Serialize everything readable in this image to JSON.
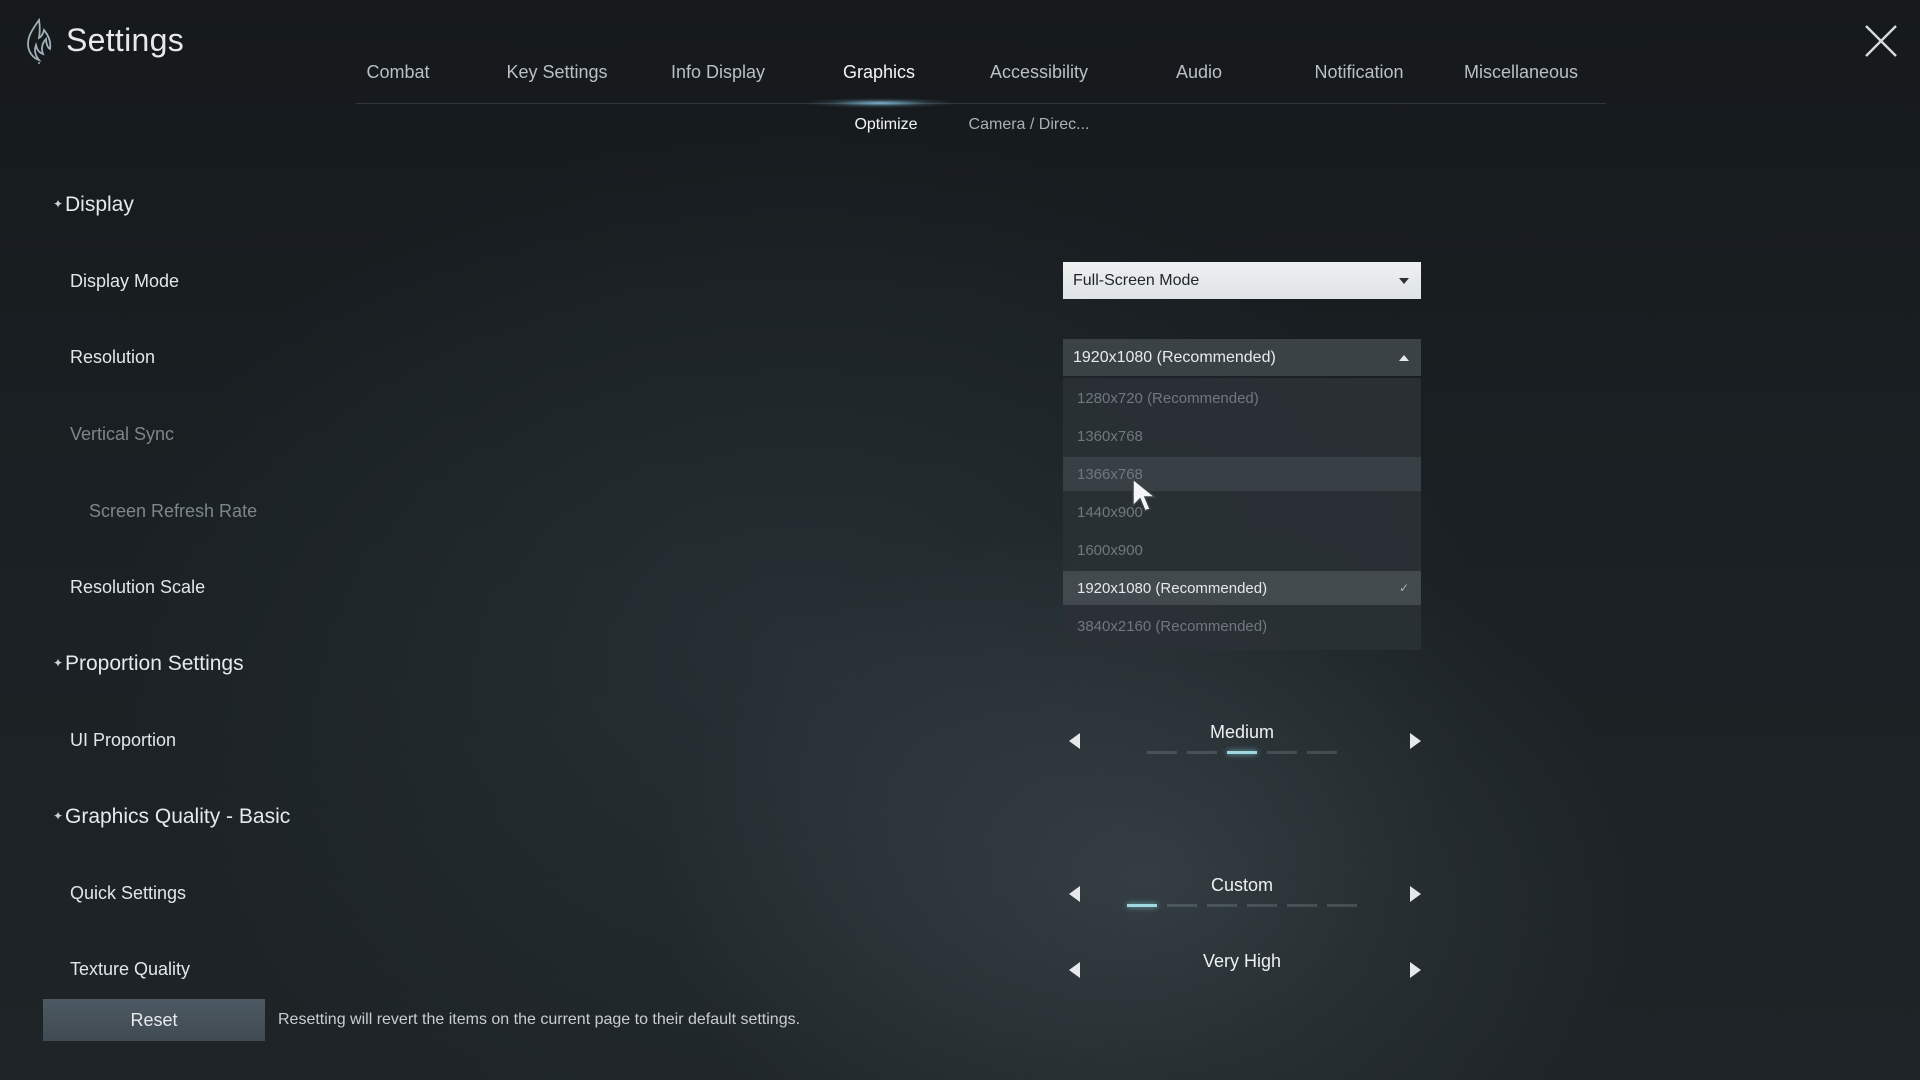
{
  "header": {
    "title": "Settings",
    "logo_icon": "flame-emblem-icon",
    "close_icon": "close-icon"
  },
  "tabs": [
    {
      "label": "Combat"
    },
    {
      "label": "Key Settings"
    },
    {
      "label": "Info Display"
    },
    {
      "label": "Graphics",
      "active": true
    },
    {
      "label": "Accessibility"
    },
    {
      "label": "Audio"
    },
    {
      "label": "Notification"
    },
    {
      "label": "Miscellaneous"
    }
  ],
  "subtabs": [
    {
      "label": "Optimize",
      "active": true
    },
    {
      "label": "Camera / Direc..."
    }
  ],
  "sections": {
    "display": {
      "title": "Display"
    },
    "proportion": {
      "title": "Proportion Settings"
    },
    "graphics_basic": {
      "title": "Graphics Quality - Basic"
    }
  },
  "settings": {
    "display_mode": {
      "label": "Display Mode",
      "value": "Full-Screen Mode"
    },
    "resolution": {
      "label": "Resolution",
      "value": "1920x1080 (Recommended)",
      "options": [
        "1280x720 (Recommended)",
        "1360x768",
        "1366x768",
        "1440x900",
        "1600x900",
        "1920x1080 (Recommended)",
        "3840x2160 (Recommended)"
      ],
      "selected_index": 5,
      "check_icon": "checkmark-icon"
    },
    "vertical_sync": {
      "label": "Vertical Sync"
    },
    "screen_refresh_rate": {
      "label": "Screen Refresh Rate"
    },
    "resolution_scale": {
      "label": "Resolution Scale"
    },
    "ui_proportion": {
      "label": "UI Proportion",
      "value": "Medium",
      "level_index": 2,
      "level_count": 5
    },
    "quick_settings": {
      "label": "Quick Settings",
      "value": "Custom",
      "level_index": 0,
      "level_count": 6
    },
    "texture_quality": {
      "label": "Texture Quality",
      "value": "Very High"
    }
  },
  "footer": {
    "reset_label": "Reset",
    "reset_note": "Resetting will revert the items on the current page to their default settings."
  },
  "colors": {
    "accent": "#9fd8df",
    "dropdown_bg": "#e6e9eb",
    "reset_bg": "#46525a"
  }
}
